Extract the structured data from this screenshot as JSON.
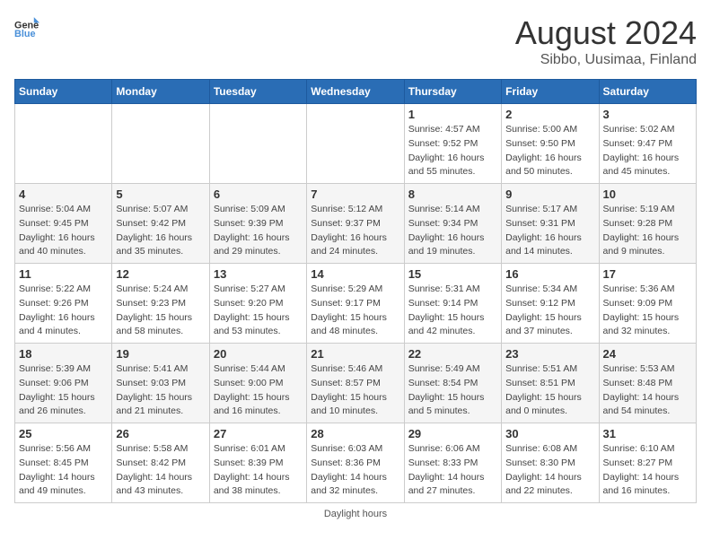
{
  "header": {
    "logo_general": "General",
    "logo_blue": "Blue",
    "title": "August 2024",
    "subtitle": "Sibbo, Uusimaa, Finland"
  },
  "calendar": {
    "days_of_week": [
      "Sunday",
      "Monday",
      "Tuesday",
      "Wednesday",
      "Thursday",
      "Friday",
      "Saturday"
    ],
    "weeks": [
      [
        {
          "day": "",
          "info": ""
        },
        {
          "day": "",
          "info": ""
        },
        {
          "day": "",
          "info": ""
        },
        {
          "day": "",
          "info": ""
        },
        {
          "day": "1",
          "info": "Sunrise: 4:57 AM\nSunset: 9:52 PM\nDaylight: 16 hours\nand 55 minutes."
        },
        {
          "day": "2",
          "info": "Sunrise: 5:00 AM\nSunset: 9:50 PM\nDaylight: 16 hours\nand 50 minutes."
        },
        {
          "day": "3",
          "info": "Sunrise: 5:02 AM\nSunset: 9:47 PM\nDaylight: 16 hours\nand 45 minutes."
        }
      ],
      [
        {
          "day": "4",
          "info": "Sunrise: 5:04 AM\nSunset: 9:45 PM\nDaylight: 16 hours\nand 40 minutes."
        },
        {
          "day": "5",
          "info": "Sunrise: 5:07 AM\nSunset: 9:42 PM\nDaylight: 16 hours\nand 35 minutes."
        },
        {
          "day": "6",
          "info": "Sunrise: 5:09 AM\nSunset: 9:39 PM\nDaylight: 16 hours\nand 29 minutes."
        },
        {
          "day": "7",
          "info": "Sunrise: 5:12 AM\nSunset: 9:37 PM\nDaylight: 16 hours\nand 24 minutes."
        },
        {
          "day": "8",
          "info": "Sunrise: 5:14 AM\nSunset: 9:34 PM\nDaylight: 16 hours\nand 19 minutes."
        },
        {
          "day": "9",
          "info": "Sunrise: 5:17 AM\nSunset: 9:31 PM\nDaylight: 16 hours\nand 14 minutes."
        },
        {
          "day": "10",
          "info": "Sunrise: 5:19 AM\nSunset: 9:28 PM\nDaylight: 16 hours\nand 9 minutes."
        }
      ],
      [
        {
          "day": "11",
          "info": "Sunrise: 5:22 AM\nSunset: 9:26 PM\nDaylight: 16 hours\nand 4 minutes."
        },
        {
          "day": "12",
          "info": "Sunrise: 5:24 AM\nSunset: 9:23 PM\nDaylight: 15 hours\nand 58 minutes."
        },
        {
          "day": "13",
          "info": "Sunrise: 5:27 AM\nSunset: 9:20 PM\nDaylight: 15 hours\nand 53 minutes."
        },
        {
          "day": "14",
          "info": "Sunrise: 5:29 AM\nSunset: 9:17 PM\nDaylight: 15 hours\nand 48 minutes."
        },
        {
          "day": "15",
          "info": "Sunrise: 5:31 AM\nSunset: 9:14 PM\nDaylight: 15 hours\nand 42 minutes."
        },
        {
          "day": "16",
          "info": "Sunrise: 5:34 AM\nSunset: 9:12 PM\nDaylight: 15 hours\nand 37 minutes."
        },
        {
          "day": "17",
          "info": "Sunrise: 5:36 AM\nSunset: 9:09 PM\nDaylight: 15 hours\nand 32 minutes."
        }
      ],
      [
        {
          "day": "18",
          "info": "Sunrise: 5:39 AM\nSunset: 9:06 PM\nDaylight: 15 hours\nand 26 minutes."
        },
        {
          "day": "19",
          "info": "Sunrise: 5:41 AM\nSunset: 9:03 PM\nDaylight: 15 hours\nand 21 minutes."
        },
        {
          "day": "20",
          "info": "Sunrise: 5:44 AM\nSunset: 9:00 PM\nDaylight: 15 hours\nand 16 minutes."
        },
        {
          "day": "21",
          "info": "Sunrise: 5:46 AM\nSunset: 8:57 PM\nDaylight: 15 hours\nand 10 minutes."
        },
        {
          "day": "22",
          "info": "Sunrise: 5:49 AM\nSunset: 8:54 PM\nDaylight: 15 hours\nand 5 minutes."
        },
        {
          "day": "23",
          "info": "Sunrise: 5:51 AM\nSunset: 8:51 PM\nDaylight: 15 hours\nand 0 minutes."
        },
        {
          "day": "24",
          "info": "Sunrise: 5:53 AM\nSunset: 8:48 PM\nDaylight: 14 hours\nand 54 minutes."
        }
      ],
      [
        {
          "day": "25",
          "info": "Sunrise: 5:56 AM\nSunset: 8:45 PM\nDaylight: 14 hours\nand 49 minutes."
        },
        {
          "day": "26",
          "info": "Sunrise: 5:58 AM\nSunset: 8:42 PM\nDaylight: 14 hours\nand 43 minutes."
        },
        {
          "day": "27",
          "info": "Sunrise: 6:01 AM\nSunset: 8:39 PM\nDaylight: 14 hours\nand 38 minutes."
        },
        {
          "day": "28",
          "info": "Sunrise: 6:03 AM\nSunset: 8:36 PM\nDaylight: 14 hours\nand 32 minutes."
        },
        {
          "day": "29",
          "info": "Sunrise: 6:06 AM\nSunset: 8:33 PM\nDaylight: 14 hours\nand 27 minutes."
        },
        {
          "day": "30",
          "info": "Sunrise: 6:08 AM\nSunset: 8:30 PM\nDaylight: 14 hours\nand 22 minutes."
        },
        {
          "day": "31",
          "info": "Sunrise: 6:10 AM\nSunset: 8:27 PM\nDaylight: 14 hours\nand 16 minutes."
        }
      ]
    ]
  },
  "footer": {
    "text": "Daylight hours"
  }
}
